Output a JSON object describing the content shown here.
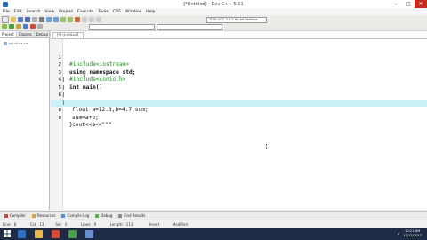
{
  "window": {
    "title": "[*Untitled] - Dev-C++ 5.11"
  },
  "menubar": {
    "items": [
      "File",
      "Edit",
      "Search",
      "View",
      "Project",
      "Execute",
      "Tools",
      "CVS",
      "Window",
      "Help"
    ]
  },
  "toolbar": {
    "compiler_select": "TDM-GCC 4.9.2 64-bit Release",
    "scope_select": "",
    "symbol_select": ""
  },
  "left_panel": {
    "tabs": [
      "Project",
      "Classes",
      "Debug"
    ],
    "tree": [
      "tgl.cincs.cx"
    ]
  },
  "editor": {
    "tab_label": "[*] Untitled1",
    "lines": [
      {
        "num": "1",
        "text": "#include<iostream>"
      },
      {
        "num": "2",
        "text": "using namespace std;"
      },
      {
        "num": "3",
        "text": "#include<conio.h>"
      },
      {
        "num": "4",
        "text": "int main()"
      },
      {
        "num": "5",
        "text": "{"
      },
      {
        "num": "6",
        "text": "float a=12.3,b=4.7,sum;"
      },
      {
        "num": "7",
        "text": "sum=a+b;"
      },
      {
        "num": "8",
        "text": "cout<<a<<\"\"\""
      },
      {
        "num": "9",
        "text": "}"
      }
    ]
  },
  "bottom_tabs": [
    "Compiler",
    "Resources",
    "Compile Log",
    "Debug",
    "Find Results"
  ],
  "statusbar": {
    "line_label": "Line:",
    "line_value": "8",
    "col_label": "Col:",
    "col_value": "13",
    "sel_label": "Sel:",
    "sel_value": "0",
    "lines_label": "Lines:",
    "lines_value": "9",
    "length_label": "Length:",
    "length_value": "113",
    "mode": "Insert",
    "status": "Modified"
  },
  "taskbar": {
    "time": "10:21 AM",
    "date": "12/12/2017"
  },
  "colors": {
    "current_line": "#c9f1f6",
    "preprocessor": "#1a8f1a",
    "number": "#7a2fb3",
    "string": "#1c3fd6",
    "taskbar": "#1f2a44"
  }
}
